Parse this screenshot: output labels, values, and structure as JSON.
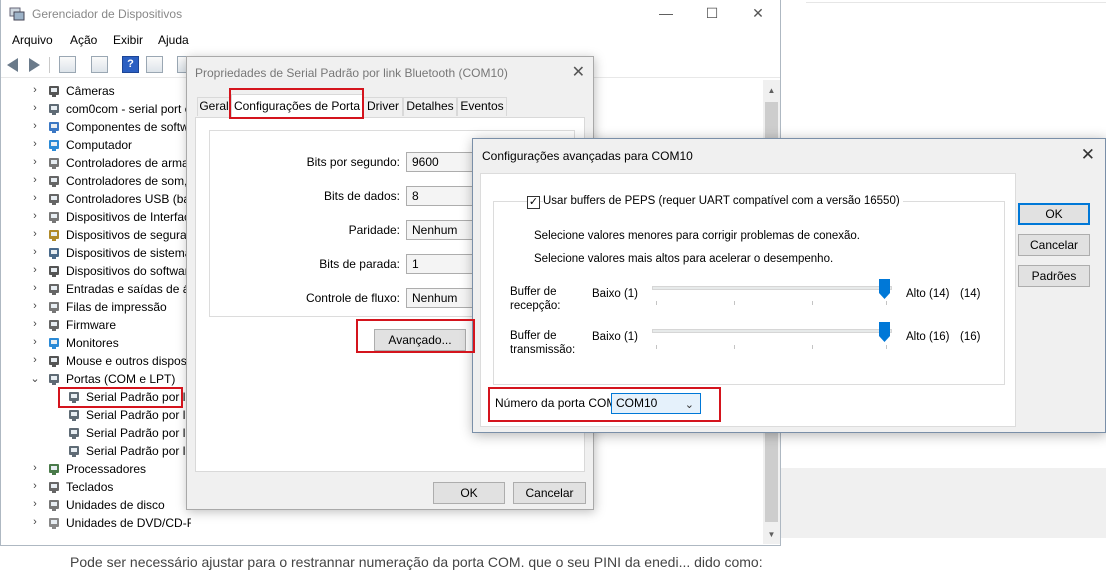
{
  "device_manager": {
    "title": "Gerenciador de Dispositivos",
    "window_controls": {
      "minimize": "—",
      "maximize": "☐",
      "close": "✕"
    },
    "menu": [
      "Arquivo",
      "Ação",
      "Exibir",
      "Ajuda"
    ],
    "toolbar": {
      "help_label": "?"
    },
    "tree": [
      {
        "label": "Câmeras",
        "icon": "camera-icon",
        "expanded": false
      },
      {
        "label": "com0com - serial port e",
        "icon": "port-icon",
        "expanded": false
      },
      {
        "label": "Componentes de softw",
        "icon": "component-icon",
        "expanded": false
      },
      {
        "label": "Computador",
        "icon": "monitor-icon",
        "expanded": false
      },
      {
        "label": "Controladores de arma",
        "icon": "storage-icon",
        "expanded": false
      },
      {
        "label": "Controladores de som,",
        "icon": "speaker-icon",
        "expanded": false
      },
      {
        "label": "Controladores USB (bar",
        "icon": "usb-icon",
        "expanded": false
      },
      {
        "label": "Dispositivos de Interfac",
        "icon": "hid-icon",
        "expanded": false
      },
      {
        "label": "Dispositivos de segurar",
        "icon": "security-icon",
        "expanded": false
      },
      {
        "label": "Dispositivos de sistema",
        "icon": "system-icon",
        "expanded": false
      },
      {
        "label": "Dispositivos do softwar",
        "icon": "software-device-icon",
        "expanded": false
      },
      {
        "label": "Entradas e saídas de áu",
        "icon": "audio-io-icon",
        "expanded": false
      },
      {
        "label": "Filas de impressão",
        "icon": "printer-icon",
        "expanded": false
      },
      {
        "label": "Firmware",
        "icon": "firmware-icon",
        "expanded": false
      },
      {
        "label": "Monitores",
        "icon": "monitor-icon",
        "expanded": false
      },
      {
        "label": "Mouse e outros disposi",
        "icon": "mouse-icon",
        "expanded": false
      },
      {
        "label": "Portas (COM e LPT)",
        "icon": "port-icon",
        "expanded": true
      },
      {
        "label": "Serial Padrão por li",
        "icon": "port-icon",
        "child": true,
        "highlighted": true
      },
      {
        "label": "Serial Padrão por lir",
        "icon": "port-icon",
        "child": true
      },
      {
        "label": "Serial Padrão por lir",
        "icon": "port-icon",
        "child": true
      },
      {
        "label": "Serial Padrão por lir",
        "icon": "port-icon",
        "child": true
      },
      {
        "label": "Processadores",
        "icon": "cpu-icon",
        "expanded": false
      },
      {
        "label": "Teclados",
        "icon": "keyboard-icon",
        "expanded": false
      },
      {
        "label": "Unidades de disco",
        "icon": "disk-icon",
        "expanded": false
      },
      {
        "label": "Unidades de DVD/CD-ROM",
        "icon": "dvd-icon",
        "expanded": false
      }
    ]
  },
  "properties_dialog": {
    "title": "Propriedades de Serial Padrão por link Bluetooth (COM10)",
    "close": "✕",
    "tabs": [
      "Geral",
      "Configurações de Porta",
      "Driver",
      "Detalhes",
      "Eventos"
    ],
    "active_tab": "Configurações de Porta",
    "fields": [
      {
        "label": "Bits por segundo:",
        "value": "9600"
      },
      {
        "label": "Bits de dados:",
        "value": "8"
      },
      {
        "label": "Paridade:",
        "value": "Nenhum"
      },
      {
        "label": "Bits de parada:",
        "value": "1"
      },
      {
        "label": "Controle de fluxo:",
        "value": "Nenhum"
      }
    ],
    "advanced_button": "Avançado...",
    "ok_button": "OK",
    "cancel_button": "Cancelar"
  },
  "advanced_dialog": {
    "title": "Configurações avançadas para COM10",
    "close": "✕",
    "use_fifo_label": "Usar buffers de PEPS (requer UART compatível com a versão 16550)",
    "use_fifo_checked": true,
    "check_mark": "✓",
    "hint_low": "Selecione valores menores para corrigir problemas de conexão.",
    "hint_high": "Selecione valores mais altos para acelerar o desempenho.",
    "receive_buffer": {
      "label_line1": "Buffer de",
      "label_line2": "recepção:",
      "low": "Baixo (1)",
      "high": "Alto (14)",
      "value": "(14)",
      "level": 1.0
    },
    "transmit_buffer": {
      "label_line1": "Buffer de",
      "label_line2": "transmissão:",
      "low": "Baixo (1)",
      "high": "Alto (16)",
      "value": "(16)",
      "level": 1.0
    },
    "com_port_label": "Número da porta COM:",
    "com_port_value": "COM10",
    "ok_button": "OK",
    "cancel_button": "Cancelar",
    "defaults_button": "Padrões"
  },
  "background": {
    "caption": "Pode ser necessário ajustar para o restrannar numeração da porta COM. que o seu PINI da enedi... dido como:"
  },
  "colors": {
    "highlight": "#d4141d",
    "accent": "#0078d7"
  }
}
